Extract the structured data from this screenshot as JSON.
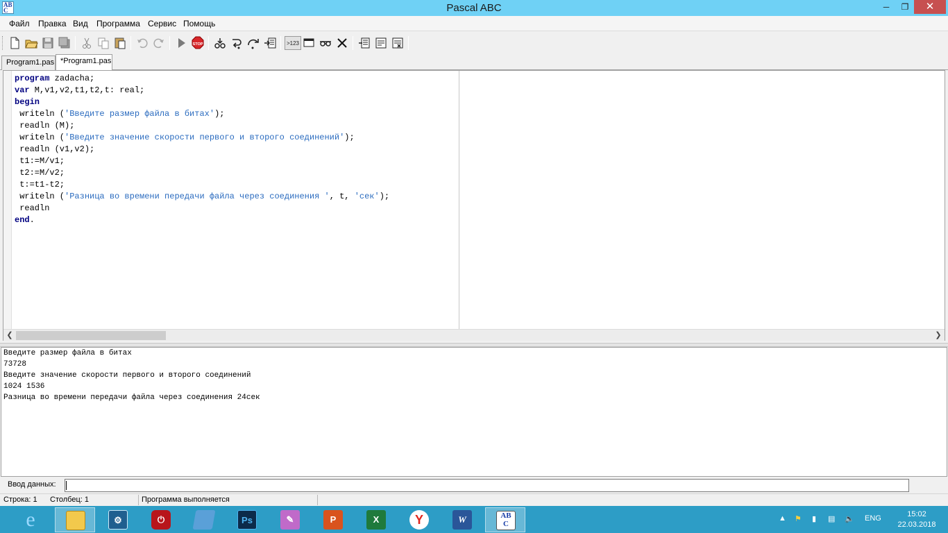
{
  "window": {
    "title": "Pascal ABC",
    "icon_text": "AB\nC"
  },
  "menu": [
    "Файл",
    "Правка",
    "Вид",
    "Программа",
    "Сервис",
    "Помощь"
  ],
  "toolbar_icons": [
    "new-file-icon",
    "open-folder-icon",
    "save-icon",
    "save-all-icon",
    "cut-icon",
    "copy-icon",
    "paste-icon",
    "undo-icon",
    "redo-icon",
    "run-icon",
    "stop-icon",
    "step-icon",
    "step-into-icon",
    "step-over-icon",
    "run-to-cursor-icon",
    "watch-icon",
    "window-icon",
    "glasses-icon",
    "close-x-icon",
    "compile-icon",
    "rebuild-icon",
    "settings-icon"
  ],
  "tabs": [
    "Program1.pas",
    "*Program1.pas"
  ],
  "editor": {
    "lines": [
      [
        {
          "t": "program",
          "k": "kw"
        },
        {
          "t": " zadacha;"
        }
      ],
      [
        {
          "t": "var",
          "k": "kw"
        },
        {
          "t": " M,v1,v2,t1,t2,t: real;"
        }
      ],
      [
        {
          "t": "begin",
          "k": "kw"
        }
      ],
      [
        {
          "t": " writeln ("
        },
        {
          "t": "'Введите размер файла в битах'",
          "k": "str"
        },
        {
          "t": ");"
        }
      ],
      [
        {
          "t": " readln (M);"
        }
      ],
      [
        {
          "t": " writeln ("
        },
        {
          "t": "'Введите значение скорости первого и второго соединений'",
          "k": "str"
        },
        {
          "t": ");"
        }
      ],
      [
        {
          "t": " readln (v1,v2);"
        }
      ],
      [
        {
          "t": " t1:=M/v1;"
        }
      ],
      [
        {
          "t": " t2:=M/v2;"
        }
      ],
      [
        {
          "t": " t:=t1-t2;"
        }
      ],
      [
        {
          "t": " writeln ("
        },
        {
          "t": "'Разница во времени передачи файла через соединения '",
          "k": "str"
        },
        {
          "t": ", t, "
        },
        {
          "t": "'сек'",
          "k": "str"
        },
        {
          "t": ");"
        }
      ],
      [
        {
          "t": " readln"
        }
      ],
      [
        {
          "t": "end",
          "k": "kw"
        },
        {
          "t": "."
        }
      ]
    ]
  },
  "output": {
    "lines": [
      "Введите размер файла в битах",
      "73728",
      "Введите значение скорости первого и второго соединений",
      "1024 1536",
      "Разница во времени передачи файла через соединения 24сек"
    ]
  },
  "input": {
    "label": "Ввод данных:",
    "value": ""
  },
  "status": {
    "row": "Строка: 1",
    "col": "Столбец: 1",
    "message": "Программа выполняется"
  },
  "taskbar": {
    "apps": [
      "internet-explorer",
      "file-explorer",
      "control-panel",
      "power-button",
      "remote-desktop",
      "photoshop",
      "paint",
      "powerpoint",
      "excel",
      "yandex-browser",
      "word",
      "pascal-abc"
    ],
    "active": "pascal-abc",
    "lang": "ENG",
    "time": "15:02",
    "date": "22.03.2018"
  },
  "colors": {
    "titlebar": "#6fd1f5",
    "taskbar": "#2d9dc6",
    "keyword": "#000080",
    "string": "#2a6bbf",
    "close": "#c75050"
  }
}
